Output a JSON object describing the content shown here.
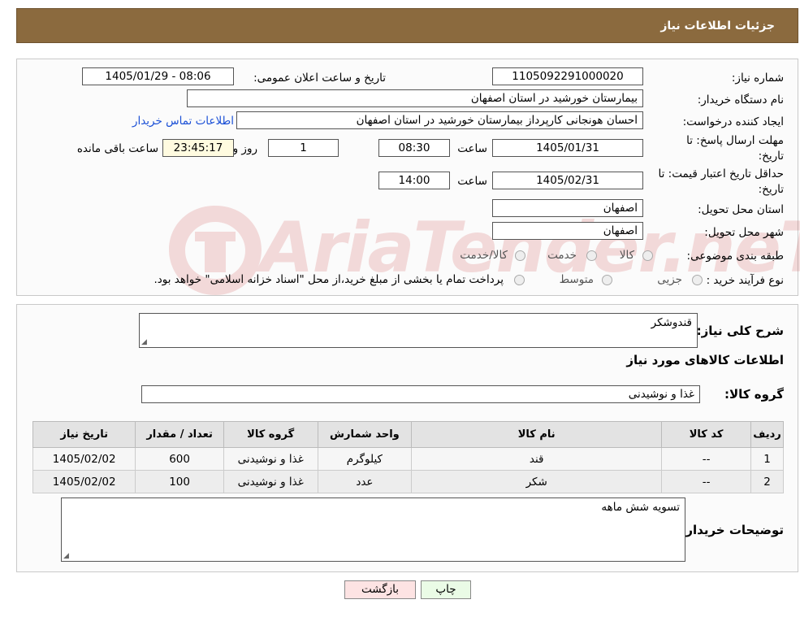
{
  "header": {
    "title": "جزئیات اطلاعات نیاز"
  },
  "form": {
    "need_number_label": "شماره نیاز:",
    "need_number": "1105092291000020",
    "announce_label": "تاریخ و ساعت اعلان عمومی:",
    "announce_value": "1405/01/29 - 08:06",
    "buyer_org_label": "نام دستگاه خریدار:",
    "buyer_org": "بیمارستان خورشید در استان اصفهان",
    "requester_label": "ایجاد کننده درخواست:",
    "requester": "احسان هونجانی کارپرداز بیمارستان خورشید در استان اصفهان",
    "contact_link": "اطلاعات تماس خریدار",
    "deadline_label_1": "مهلت ارسال پاسخ: تا",
    "deadline_label_2": "تاریخ:",
    "deadline_date": "1405/01/31",
    "time_label": "ساعت",
    "deadline_time": "08:30",
    "days_value": "1",
    "days_label": "روز و",
    "remaining_value": "23:45:17",
    "remaining_label": "ساعت باقی مانده",
    "price_validity_label_1": "حداقل تاریخ اعتبار قیمت: تا",
    "price_validity_label_2": "تاریخ:",
    "price_validity_date": "1405/02/31",
    "price_validity_time": "14:00",
    "province_label": "استان محل تحویل:",
    "province": "اصفهان",
    "city_label": "شهر محل تحویل:",
    "city": "اصفهان",
    "category_label": "طبقه بندی موضوعی:",
    "category_options": [
      "کالا",
      "خدمت",
      "کالا/خدمت"
    ],
    "process_label": "نوع فرآیند خرید :",
    "process_options": [
      "جزیی",
      "متوسط"
    ],
    "process_note": "پرداخت تمام یا بخشی از مبلغ خرید،از محل \"اسناد خزانه اسلامی\" خواهد بود."
  },
  "details": {
    "summary_label": "شرح کلی نیاز:",
    "summary": "قندوشکر",
    "items_title": "اطلاعات کالاهای مورد نیاز",
    "group_label": "گروه کالا:",
    "group": "غذا و نوشیدنی",
    "table": {
      "headers": [
        "ردیف",
        "کد کالا",
        "نام کالا",
        "واحد شمارش",
        "گروه کالا",
        "تعداد / مقدار",
        "تاریخ نیاز"
      ],
      "rows": [
        [
          "1",
          "--",
          "قند",
          "کیلوگرم",
          "غذا و نوشیدنی",
          "600",
          "1405/02/02"
        ],
        [
          "2",
          "--",
          "شکر",
          "عدد",
          "غذا و نوشیدنی",
          "100",
          "1405/02/02"
        ]
      ]
    },
    "notes_label": "توضیحات خریدار:",
    "notes": "تسویه شش ماهه"
  },
  "buttons": {
    "print": "چاپ",
    "back": "بازگشت"
  },
  "watermark": {
    "text": "AriaTender.neT",
    "color": "#b00000"
  }
}
